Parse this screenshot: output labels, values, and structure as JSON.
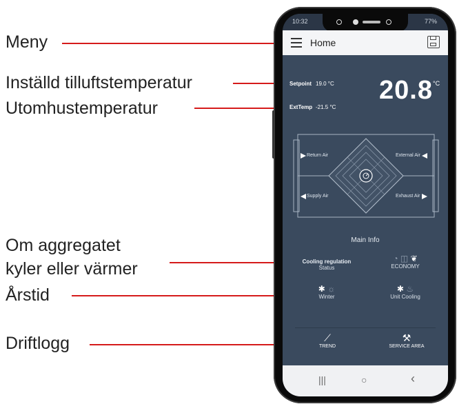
{
  "annotations": {
    "menu": "Meny",
    "setpoint": "Inställd tilluftstemperatur",
    "outdoor": "Utomhustemperatur",
    "cooling_line1": "Om aggregatet",
    "cooling_line2": "kyler eller värmer",
    "season": "Årstid",
    "log": "Driftlogg"
  },
  "status_bar": {
    "time": "10:32",
    "battery": "77%"
  },
  "app_bar": {
    "title": "Home",
    "menu_icon": "hamburger-icon",
    "save_icon": "floppy-disk-icon"
  },
  "readings": {
    "setpoint_label": "Setpoint",
    "setpoint_value": "19.0 °C",
    "exttemp_label": "ExtTemp",
    "exttemp_value": "-21.5 °C",
    "current_temp": "20.8",
    "current_unit": "°C"
  },
  "diagram": {
    "return_air": "Return Air",
    "external_air": "External Air",
    "supply_air": "Supply Air",
    "exhaust_air": "Exhaust Air"
  },
  "main_info": {
    "title": "Main Info",
    "cooling_regulation": "Cooling regulation",
    "status": "Status",
    "mode": "ECONOMY",
    "season": "Winter",
    "unit_state": "Unit Cooling"
  },
  "bottom": {
    "trend": "TREND",
    "service": "SERVICE AREA"
  },
  "nav": {
    "recent": "|||",
    "home": "○",
    "back": "‹"
  },
  "colors": {
    "screen_bg": "#3a4a5e",
    "arrow": "#d51a1a"
  }
}
